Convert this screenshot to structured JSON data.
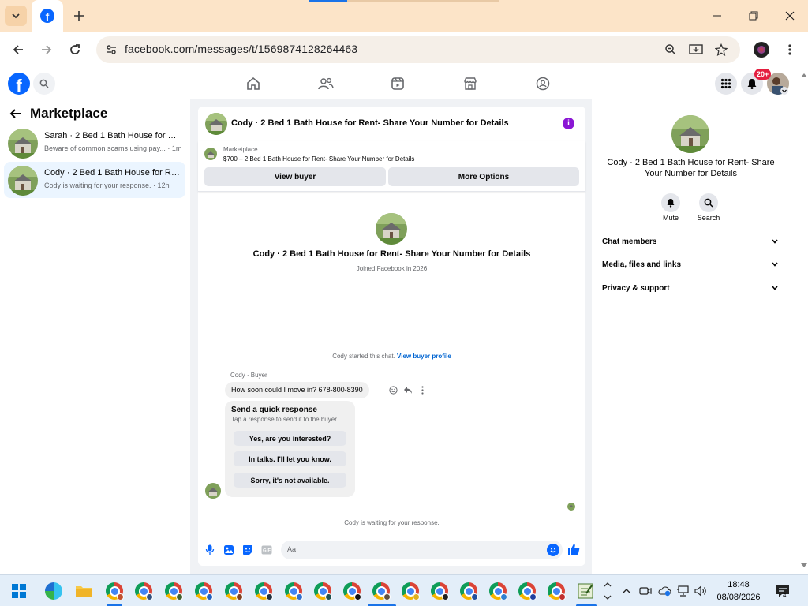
{
  "browser": {
    "url": "facebook.com/messages/t/1569874128264463",
    "tab_favicon": "facebook-icon"
  },
  "header": {
    "notification_badge": "20+"
  },
  "left_panel": {
    "title": "Marketplace",
    "conversations": [
      {
        "name": "Sarah · 2 Bed 1 Bath House for Ren...",
        "subtitle": "Beware of common scams using pay... · 1m",
        "active": false
      },
      {
        "name": "Cody · 2 Bed 1 Bath House for Ren...",
        "subtitle": "Cody is waiting for your response. · 12h",
        "active": true
      }
    ]
  },
  "chat": {
    "header_title": "Cody · 2 Bed 1 Bath House for Rent- Share Your Number for Details",
    "marketplace_label": "Marketplace",
    "listing": "$700 – 2 Bed 1 Bath House for Rent- Share Your Number for Details",
    "view_buyer": "View buyer",
    "more_options": "More Options",
    "intro_name": "Cody · 2 Bed 1 Bath House for Rent- Share Your Number for Details",
    "intro_sub": "Joined Facebook in 2026",
    "started_text": "Cody started this chat.",
    "started_link": "View buyer profile",
    "sender_label": "Cody · Buyer",
    "message": "How soon could I move in? 678-800-8390",
    "quick_title": "Send a quick response",
    "quick_sub": "Tap a response to send it to the buyer.",
    "quick_responses": [
      "Yes, are you interested?",
      "In talks. I'll let you know.",
      "Sorry, it's not available."
    ],
    "waiting": "Cody is waiting for your response.",
    "composer_placeholder": "Aa"
  },
  "right_panel": {
    "name": "Cody · 2 Bed 1 Bath House for Rent- Share Your Number for Details",
    "mute": "Mute",
    "search": "Search",
    "sections": [
      "Chat members",
      "Media, files and links",
      "Privacy & support"
    ]
  },
  "taskbar": {
    "time": "18:48",
    "date": "08/08/2026",
    "notification_count": "4"
  },
  "colors": {
    "facebook_blue": "#0866ff",
    "active_conversation": "#ebf5ff",
    "info_purple": "#8a16d4",
    "badge_red": "#e41e3f"
  }
}
